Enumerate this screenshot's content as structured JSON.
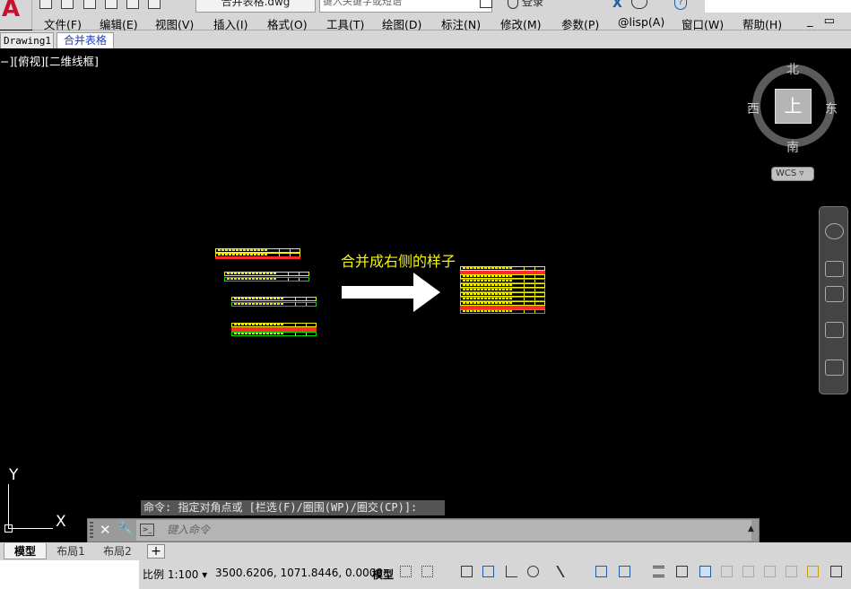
{
  "window": {
    "file_tab": "合并表格.dwg",
    "search_placeholder": "键入关键字或短语",
    "login": "登录",
    "help": "?",
    "app_logo": "A"
  },
  "menubar": {
    "items": [
      "文件(F)",
      "编辑(E)",
      "视图(V)",
      "插入(I)",
      "格式(O)",
      "工具(T)",
      "绘图(D)",
      "标注(N)",
      "修改(M)",
      "参数(P)",
      "@lisp(A)",
      "窗口(W)",
      "帮助(H)"
    ],
    "window_controls": "_ ▭ ✕"
  },
  "doc_tabs": {
    "drawing1": "Drawing1",
    "active": "合并表格"
  },
  "viewport": {
    "label": "−][俯视][二维线框]"
  },
  "viewcube": {
    "north": "北",
    "south": "南",
    "east": "东",
    "west": "西",
    "top": "上",
    "wcs": "WCS ▿"
  },
  "canvas": {
    "annotation": "合并成右侧的样子",
    "colors": {
      "yellow": "#f2f200",
      "red": "#ff2a2a",
      "green": "#00e000"
    }
  },
  "ucs": {
    "x": "X",
    "y": "Y"
  },
  "command": {
    "history": "命令: 指定对角点或 [栏选(F)/圈围(WP)/圈交(CP)]:",
    "placeholder": "键入命令",
    "close": "✕",
    "wrench": "🔧",
    "prompt_icon": ">_",
    "expand": "▲"
  },
  "layout_tabs": {
    "model": "模型",
    "layout1": "布局1",
    "layout2": "布局2",
    "add": "+"
  },
  "status": {
    "scale": "比例 1:100 ▾",
    "coordinates": "3500.6206, 1071.8446, 0.0000",
    "model": "模型"
  }
}
